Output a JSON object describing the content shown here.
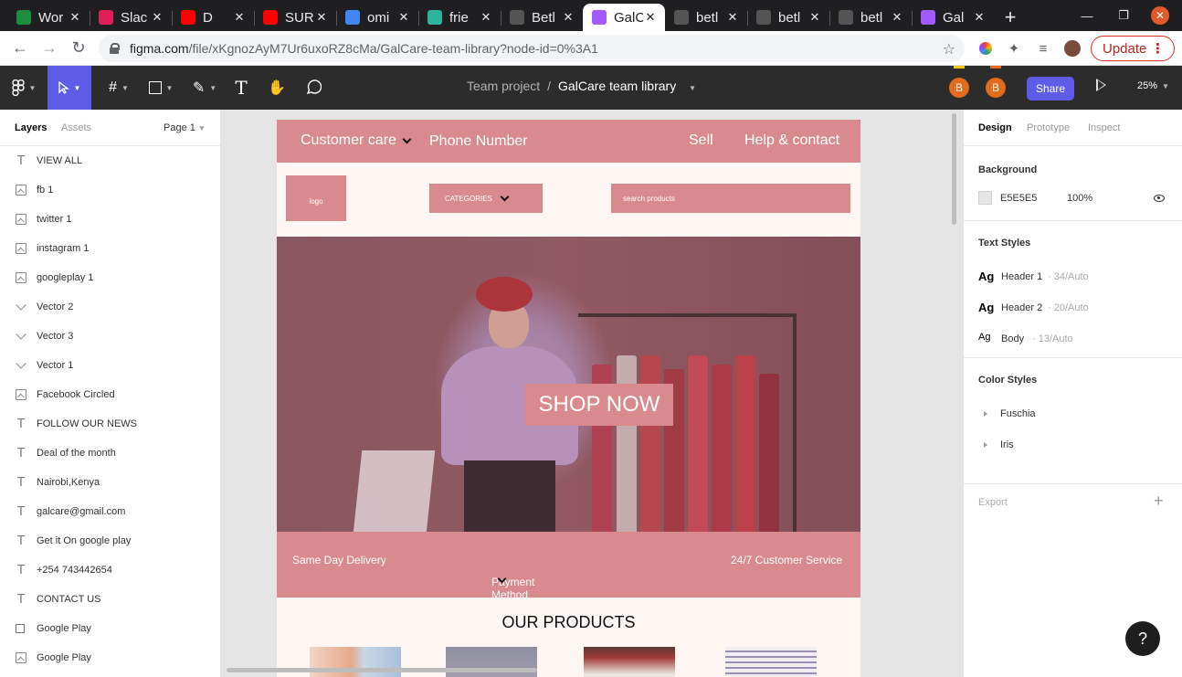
{
  "browser": {
    "tabs": [
      {
        "title": "Wor",
        "icon": "sheets-icon",
        "color": "#1e8e3e"
      },
      {
        "title": "Slac",
        "icon": "slack-icon",
        "color": "#e01e5a"
      },
      {
        "title": "D",
        "icon": "youtube-icon",
        "color": "#ff0000"
      },
      {
        "title": "SUR",
        "icon": "youtube-icon",
        "color": "#ff0000"
      },
      {
        "title": "omi",
        "icon": "google-icon",
        "color": "#4285f4"
      },
      {
        "title": "frie",
        "icon": "diamond-icon",
        "color": "#2bb59a"
      },
      {
        "title": "Betl",
        "icon": "github-icon",
        "color": "#555555"
      },
      {
        "title": "GalC",
        "icon": "figma-icon",
        "color": "#a259ff",
        "active": true
      },
      {
        "title": "betl",
        "icon": "github-icon",
        "color": "#555555"
      },
      {
        "title": "betl",
        "icon": "github-icon",
        "color": "#555555"
      },
      {
        "title": "betl",
        "icon": "github-icon",
        "color": "#555555"
      },
      {
        "title": "Gal",
        "icon": "figma-icon",
        "color": "#a259ff"
      }
    ],
    "url_host": "figma.com",
    "url_path": "/file/xKgnozAyM7Ur6uxoRZ8cMa/GalCare-team-library?node-id=0%3A1",
    "update_label": "Update"
  },
  "figma": {
    "toolbar": {
      "project": "Team project",
      "separator": "/",
      "file_name": "GalCare team library",
      "avatar1": "B",
      "avatar2": "B",
      "share_label": "Share",
      "zoom": "25%"
    },
    "left_panel": {
      "tab_layers": "Layers",
      "tab_assets": "Assets",
      "page": "Page 1",
      "layers": [
        {
          "name": "VIEW ALL",
          "type": "text"
        },
        {
          "name": "fb 1",
          "type": "image"
        },
        {
          "name": "twitter 1",
          "type": "image"
        },
        {
          "name": "instagram 1",
          "type": "image"
        },
        {
          "name": "googleplay 1",
          "type": "image"
        },
        {
          "name": "Vector 2",
          "type": "vector"
        },
        {
          "name": "Vector 3",
          "type": "vector"
        },
        {
          "name": "Vector 1",
          "type": "vector"
        },
        {
          "name": "Facebook Circled",
          "type": "image"
        },
        {
          "name": "FOLLOW OUR NEWS",
          "type": "text"
        },
        {
          "name": "Deal of the month",
          "type": "text"
        },
        {
          "name": "Nairobi,Kenya",
          "type": "text"
        },
        {
          "name": "galcare@gmail.com",
          "type": "text"
        },
        {
          "name": "Get it On google play",
          "type": "text"
        },
        {
          "name": "+254 743442654",
          "type": "text"
        },
        {
          "name": "CONTACT US",
          "type": "text"
        },
        {
          "name": "Google Play",
          "type": "rect"
        },
        {
          "name": "Google Play",
          "type": "image"
        }
      ]
    },
    "design": {
      "header_customer_care": "Customer care",
      "header_phone": "Phone Number",
      "header_sell": "Sell",
      "header_help": "Help & contact",
      "logo": "logo",
      "categories": "CATEGORIES",
      "search_placeholder": "search products",
      "shop_now": "SHOP NOW",
      "feature_delivery": "Same Day Delivery",
      "feature_payment": "Payment Method",
      "feature_service": "24/7 Customer Service",
      "products_title": "OUR PRODUCTS"
    },
    "right_panel": {
      "tab_design": "Design",
      "tab_prototype": "Prototype",
      "tab_inspect": "Inspect",
      "background_title": "Background",
      "background_hex": "E5E5E5",
      "background_opacity": "100%",
      "text_styles_title": "Text Styles",
      "text_styles": [
        {
          "name": "Header 1",
          "spec": "· 34/Auto"
        },
        {
          "name": "Header 2",
          "spec": "· 20/Auto"
        },
        {
          "name": "Body",
          "spec": "· 13/Auto"
        }
      ],
      "color_styles_title": "Color Styles",
      "color_styles": [
        "Fuschia",
        "Iris"
      ],
      "export_title": "Export"
    },
    "help": "?"
  },
  "colors": {
    "brand_pink": "#d98a8f",
    "figma_accent": "#5e5ce6",
    "canvas_bg": "#e5e5e5"
  }
}
